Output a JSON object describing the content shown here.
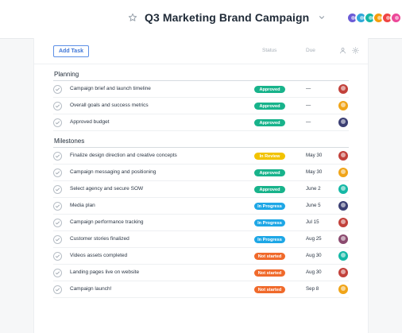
{
  "header": {
    "title": "Q3 Marketing Brand Campaign",
    "star_icon": "star-icon",
    "chevron_icon": "chevron-down-icon",
    "avatar_colors": [
      "#6b5bd6",
      "#2fa8d8",
      "#14b8a6",
      "#f59e0b",
      "#ef4444",
      "#ec4899"
    ]
  },
  "toolbar": {
    "add_task_label": "Add Task",
    "status_label": "Status",
    "due_label": "Due",
    "person_icon": "person-icon",
    "gear_icon": "gear-icon"
  },
  "colors": {
    "approved": "#18b38b",
    "in_review": "#f2c300",
    "in_progress": "#1ea7e6",
    "not_started": "#f06a2b"
  },
  "sections": [
    {
      "title": "Planning",
      "tasks": [
        {
          "name": "Campaign brief and launch timeline",
          "status": "Approved",
          "due": "—",
          "avatar_color": "#c2413b"
        },
        {
          "name": "Overall goals and success metrics",
          "status": "Approved",
          "due": "—",
          "avatar_color": "#f0a418"
        },
        {
          "name": "Approved budget",
          "status": "Approved",
          "due": "—",
          "avatar_color": "#3b3f73"
        }
      ]
    },
    {
      "title": "Milestones",
      "tasks": [
        {
          "name": "Finalize design direction and creative concepts",
          "status": "In Review",
          "due": "May 30",
          "avatar_color": "#c2413b"
        },
        {
          "name": "Campaign messaging and positioning",
          "status": "Approved",
          "due": "May 30",
          "avatar_color": "#f0a418"
        },
        {
          "name": "Select agency and secure SOW",
          "status": "Approved",
          "due": "June 2",
          "avatar_color": "#14b8a6"
        },
        {
          "name": "Media plan",
          "status": "In Progress",
          "due": "June 5",
          "avatar_color": "#3b3f73"
        },
        {
          "name": "Campaign performance tracking",
          "status": "In Progress",
          "due": "Jul 15",
          "avatar_color": "#c2413b"
        },
        {
          "name": "Customer stories finalized",
          "status": "In Progress",
          "due": "Aug 25",
          "avatar_color": "#8b4a6f"
        },
        {
          "name": "Videos assets completed",
          "status": "Not started",
          "due": "Aug 30",
          "avatar_color": "#14b8a6"
        },
        {
          "name": "Landing pages live on website",
          "status": "Not started",
          "due": "Aug 30",
          "avatar_color": "#c2413b"
        },
        {
          "name": "Campaign launch!",
          "status": "Not started",
          "due": "Sep 8",
          "avatar_color": "#f0a418"
        }
      ]
    }
  ]
}
